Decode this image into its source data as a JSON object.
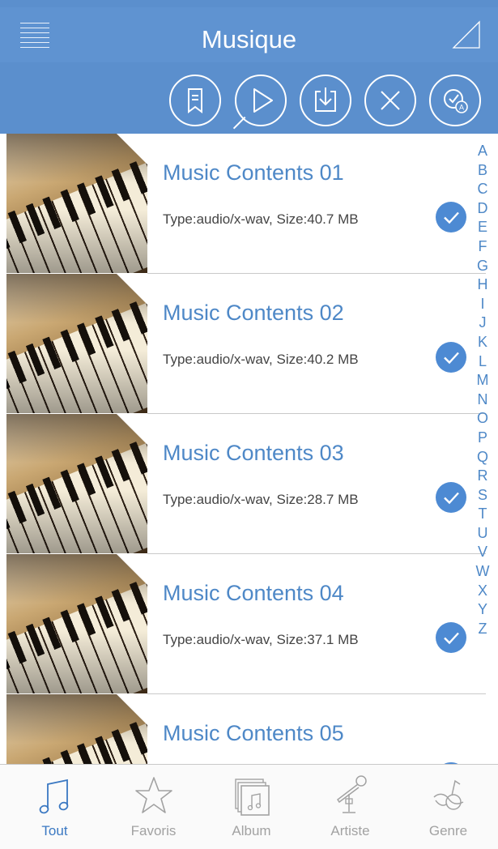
{
  "header": {
    "title": "Musique",
    "menu_icon": "hamburger-menu-icon",
    "corner_icon": "triangle-corner-icon"
  },
  "toolbar": {
    "buttons": [
      {
        "icon": "bookmark-list-icon"
      },
      {
        "icon": "play-icon"
      },
      {
        "icon": "download-icon"
      },
      {
        "icon": "close-icon"
      },
      {
        "icon": "select-all-icon"
      }
    ]
  },
  "list": {
    "items": [
      {
        "title": "Music Contents 01",
        "meta": "Type:audio/x-wav, Size:40.7 MB",
        "checked": true
      },
      {
        "title": "Music Contents 02",
        "meta": "Type:audio/x-wav, Size:40.2 MB",
        "checked": true
      },
      {
        "title": "Music Contents 03",
        "meta": "Type:audio/x-wav, Size:28.7 MB",
        "checked": true
      },
      {
        "title": "Music Contents 04",
        "meta": "Type:audio/x-wav, Size:37.1 MB",
        "checked": true
      },
      {
        "title": "Music Contents 05",
        "meta": "",
        "checked": false
      }
    ]
  },
  "index": [
    "A",
    "B",
    "C",
    "D",
    "E",
    "F",
    "G",
    "H",
    "I",
    "J",
    "K",
    "L",
    "M",
    "N",
    "O",
    "P",
    "Q",
    "R",
    "S",
    "T",
    "U",
    "V",
    "W",
    "X",
    "Y",
    "Z"
  ],
  "tabs": [
    {
      "label": "Tout",
      "icon": "music-note-icon",
      "active": true
    },
    {
      "label": "Favoris",
      "icon": "star-icon",
      "active": false
    },
    {
      "label": "Album",
      "icon": "album-icon",
      "active": false
    },
    {
      "label": "Artiste",
      "icon": "microphone-icon",
      "active": false
    },
    {
      "label": "Genre",
      "icon": "genre-icon",
      "active": false
    }
  ],
  "colors": {
    "header": "#5b8fcd",
    "accent": "#4e88c7",
    "check": "#4d8ad3",
    "tab_active": "#3a78c2",
    "tab_inactive": "#a2a2a2"
  }
}
